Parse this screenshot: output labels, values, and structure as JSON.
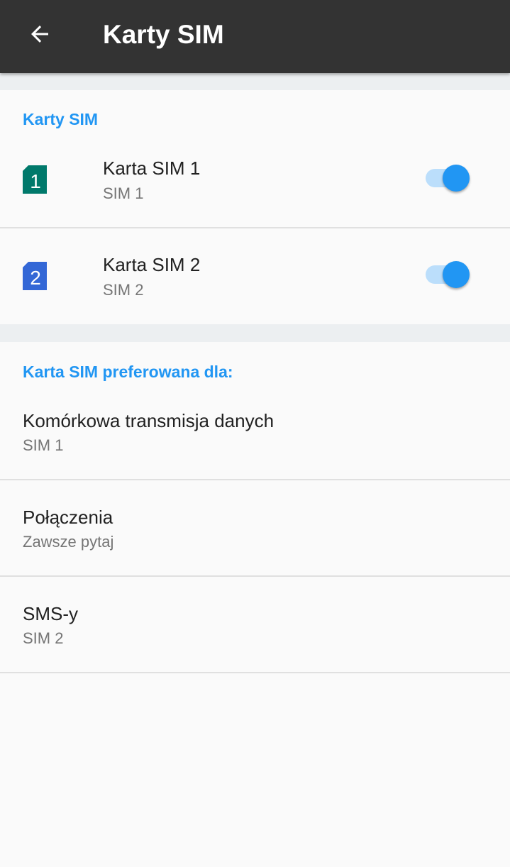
{
  "appbar": {
    "title": "Karty SIM",
    "back_icon": "arrow-back-icon"
  },
  "sim_section": {
    "header": "Karty SIM",
    "cards": [
      {
        "title": "Karta SIM 1",
        "subtitle": "SIM 1",
        "icon_number": "1",
        "icon_color": "#00796b",
        "enabled": true
      },
      {
        "title": "Karta SIM 2",
        "subtitle": "SIM 2",
        "icon_number": "2",
        "icon_color": "#3367d6",
        "enabled": true
      }
    ]
  },
  "preferred_section": {
    "header": "Karta SIM preferowana dla:",
    "items": [
      {
        "title": "Komórkowa transmisja danych",
        "value": "SIM 1"
      },
      {
        "title": "Połączenia",
        "value": "Zawsze pytaj"
      },
      {
        "title": "SMS-y",
        "value": "SIM 2"
      }
    ]
  },
  "colors": {
    "accent": "#2196f3",
    "appbar": "#333333",
    "switch_track": "#bbdefb"
  }
}
